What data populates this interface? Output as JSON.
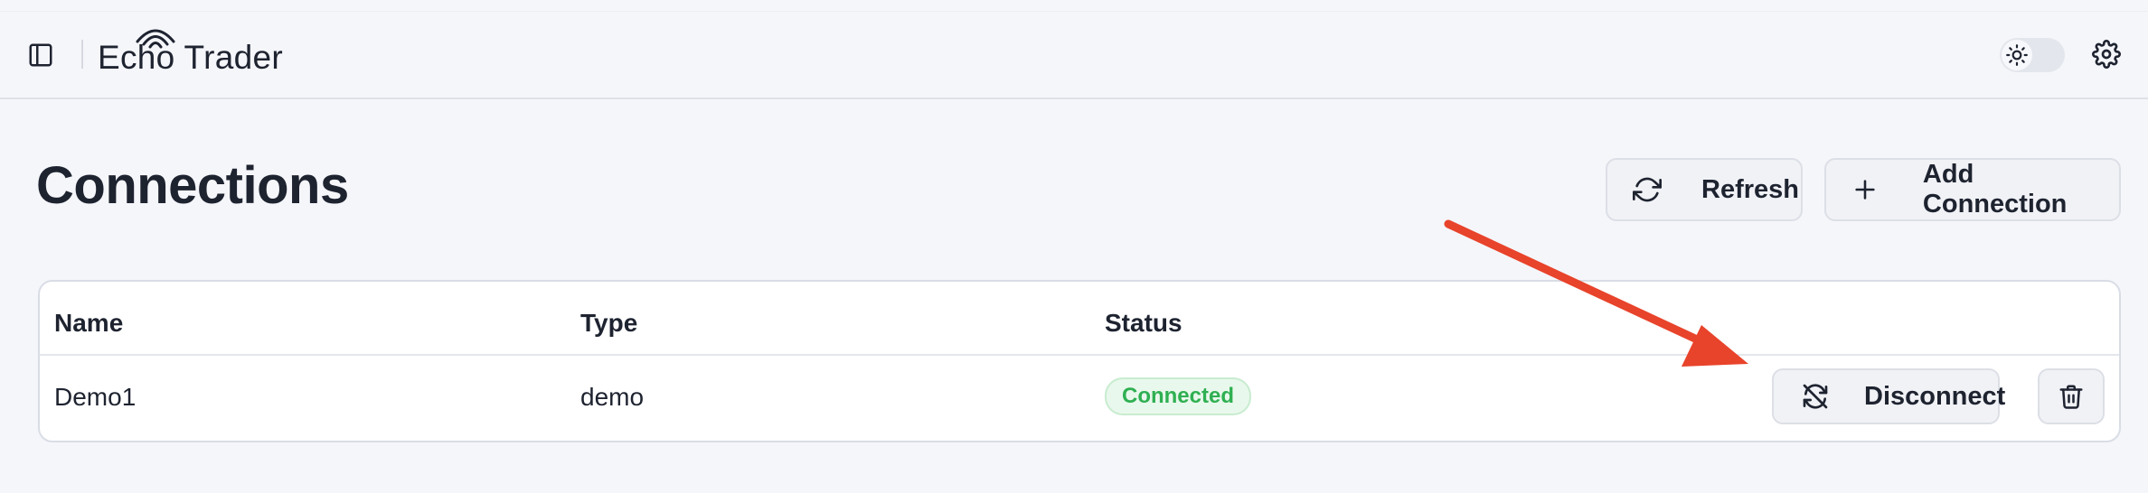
{
  "app": {
    "logo_echo": "Echo",
    "logo_trader": "Trader"
  },
  "icons": {
    "sidebar_toggle": "sidebar-panel-icon",
    "theme": "sun-icon",
    "settings": "gear-icon",
    "refresh": "refresh-icon",
    "add": "plus-icon",
    "disconnect": "disconnect-icon",
    "delete": "trash-icon"
  },
  "page": {
    "title": "Connections",
    "refresh_label": "Refresh",
    "add_label": "Add Connection"
  },
  "table": {
    "columns": [
      "Name",
      "Type",
      "Status"
    ],
    "rows": [
      {
        "name": "Demo1",
        "type": "demo",
        "status": "Connected",
        "action_label": "Disconnect"
      }
    ]
  },
  "colors": {
    "accent_status": "#2fb052",
    "annotation_arrow": "#e8432b"
  }
}
